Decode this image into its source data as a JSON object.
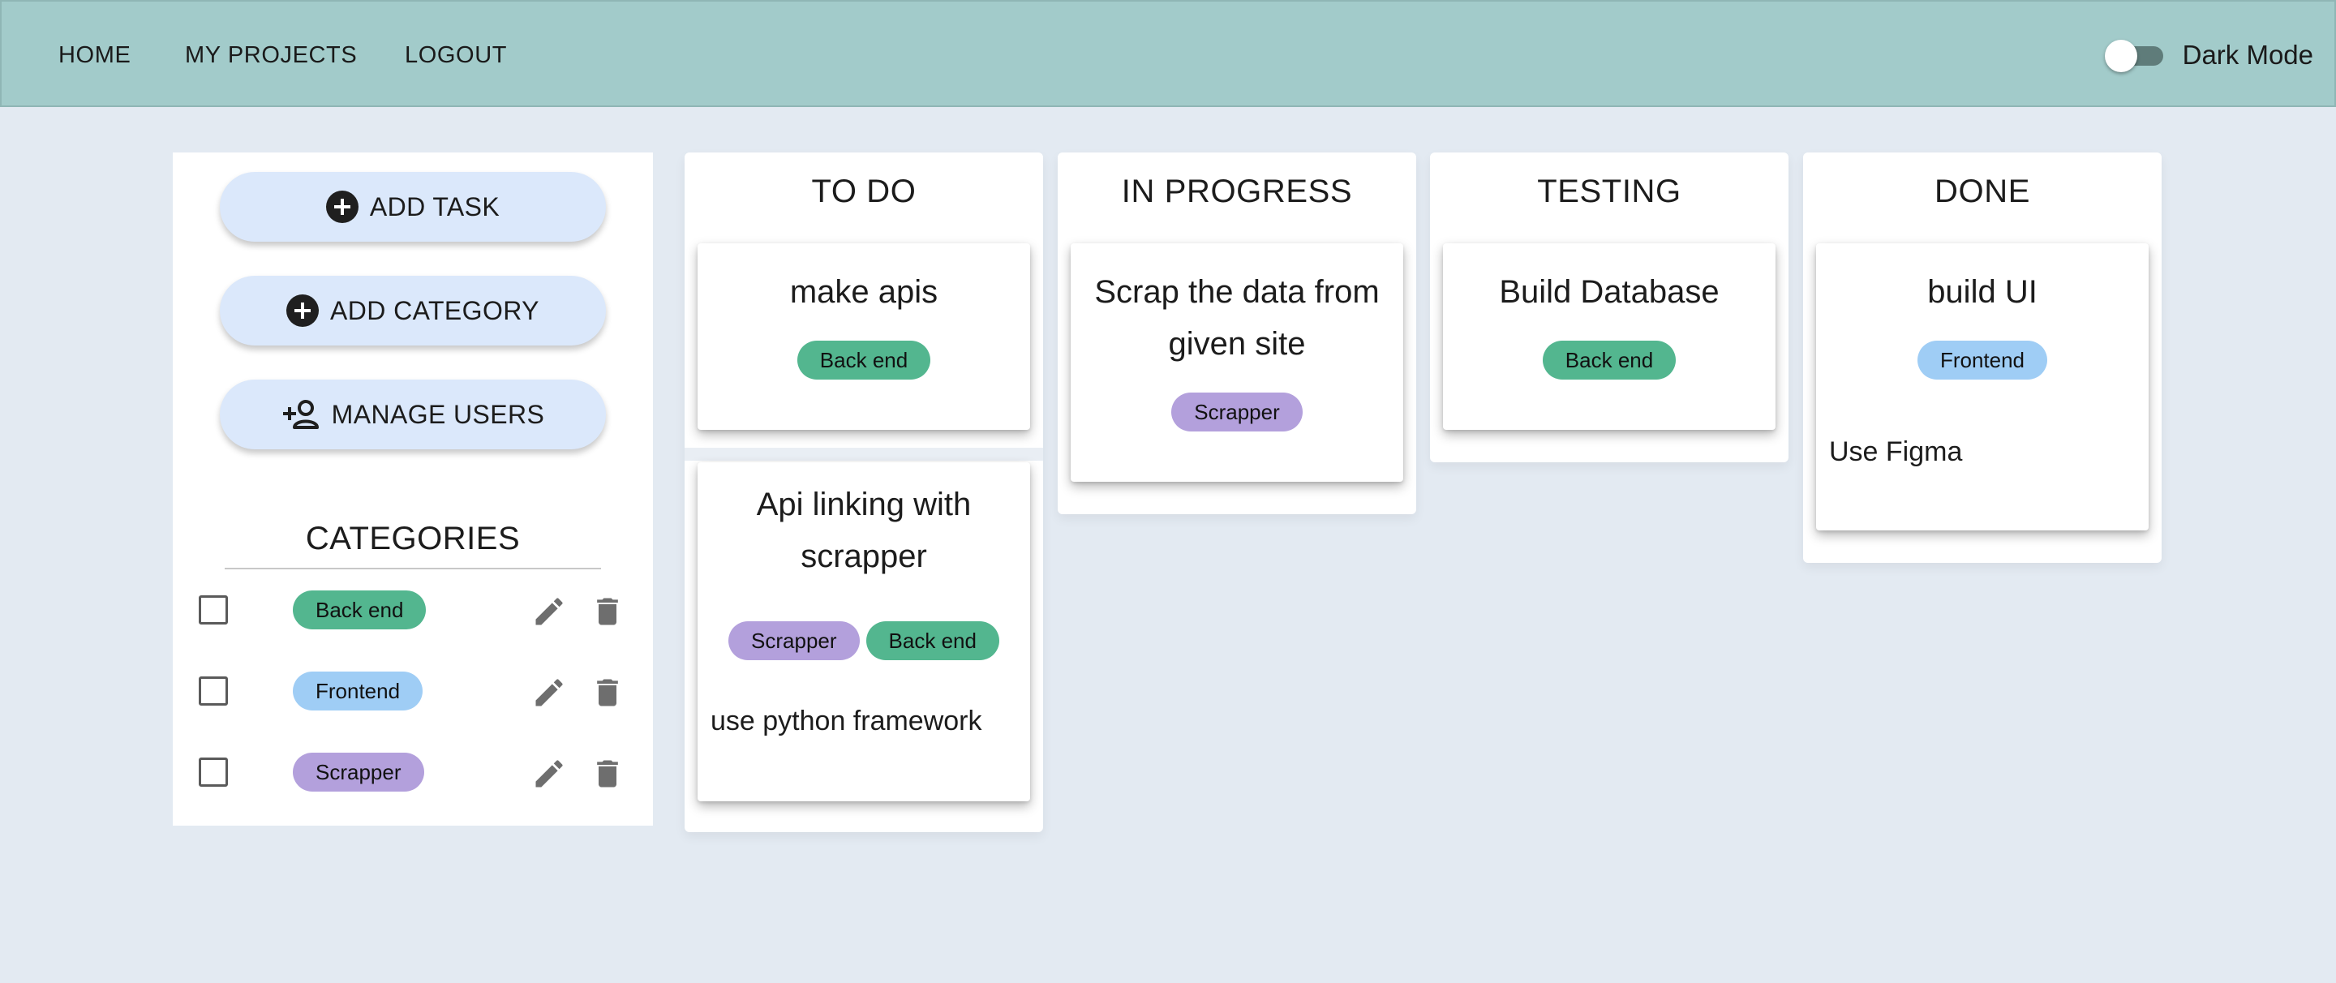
{
  "nav": {
    "home": "HOME",
    "projects": "MY PROJECTS",
    "logout": "LOGOUT",
    "dark_mode_label": "Dark Mode",
    "dark_mode_on": false
  },
  "sidebar": {
    "add_task": "ADD TASK",
    "add_category": "ADD CATEGORY",
    "manage_users": "MANAGE USERS",
    "categories_heading": "CATEGORIES",
    "categories": [
      {
        "label": "Back end",
        "color": "#53b68f",
        "checked": false
      },
      {
        "label": "Frontend",
        "color": "#9fcdf5",
        "checked": false
      },
      {
        "label": "Scrapper",
        "color": "#b3a0dc",
        "checked": false
      }
    ]
  },
  "board": {
    "columns": [
      {
        "title": "TO DO",
        "tasks": [
          {
            "title": "make apis",
            "tags": [
              "Back end"
            ],
            "description": ""
          },
          {
            "title": "Api linking with scrapper",
            "tags": [
              "Scrapper",
              "Back end"
            ],
            "description": "use python framework"
          }
        ]
      },
      {
        "title": "IN PROGRESS",
        "tasks": [
          {
            "title": "Scrap the data from given site",
            "tags": [
              "Scrapper"
            ],
            "description": ""
          }
        ]
      },
      {
        "title": "TESTING",
        "tasks": [
          {
            "title": "Build Database",
            "tags": [
              "Back end"
            ],
            "description": ""
          }
        ]
      },
      {
        "title": "DONE",
        "tasks": [
          {
            "title": "build UI",
            "tags": [
              "Frontend"
            ],
            "description": "Use Figma"
          }
        ]
      }
    ]
  },
  "colors": {
    "appbar": "#a2cbca",
    "background": "#e3eaf2",
    "pill_button": "#dbe8fb",
    "backend_tag": "#53b68f",
    "frontend_tag": "#9fcdf5",
    "scrapper_tag": "#b3a0dc"
  }
}
